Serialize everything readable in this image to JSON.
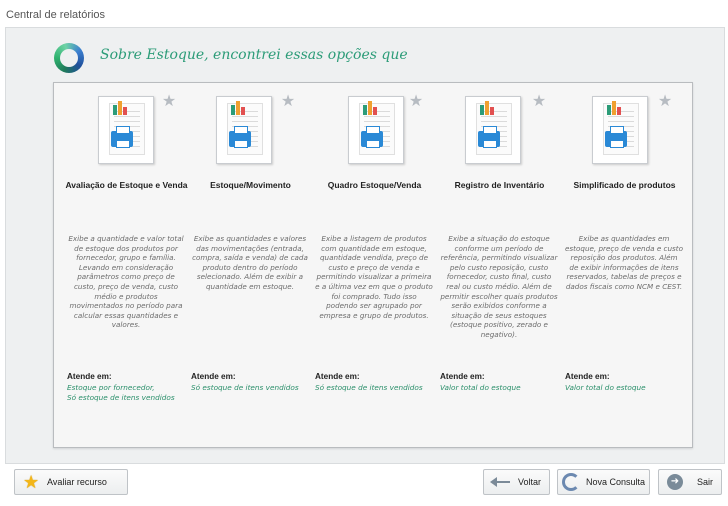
{
  "window": {
    "title": "Central de relatórios"
  },
  "header": {
    "title": "Sobre Estoque, encontrei essas opções que"
  },
  "cards": [
    {
      "title": "Avaliação de Estoque e Venda",
      "description": "Exibe a quantidade e valor total de estoque dos produtos por fornecedor, grupo e família. Levando em consideração parâmetros como preço de custo, preço de venda, custo médio e produtos movimentados no período para calcular essas quantidades e valores.",
      "attend_label": "Atende em:",
      "attend_values": [
        "Estoque por fornecedor,",
        "Só estoque de itens vendidos"
      ]
    },
    {
      "title": "Estoque/Movimento",
      "description": "Exibe as quantidades e valores das movimentações (entrada, compra, saída e venda) de cada produto dentro do período selecionado. Além de exibir a quantidade em estoque.",
      "attend_label": "Atende em:",
      "attend_values": [
        "Só estoque de itens vendidos"
      ]
    },
    {
      "title": "Quadro Estoque/Venda",
      "description": "Exibe a listagem de produtos com quantidade em estoque, quantidade vendida, preço de custo e preço de venda e permitindo visualizar a primeira e a última vez em que o produto foi comprado. Tudo isso podendo ser agrupado por empresa e grupo de produtos.",
      "attend_label": "Atende em:",
      "attend_values": [
        "Só estoque de itens vendidos"
      ]
    },
    {
      "title": "Registro de Inventário",
      "description": "Exibe a situação do estoque conforme um período de referência, permitindo visualizar pelo custo reposição, custo fornecedor, custo final, custo real ou custo médio. Além de permitir escolher quais produtos serão exibidos conforme a situação de seus estoques (estoque positivo, zerado e negativo).",
      "attend_label": "Atende em:",
      "attend_values": [
        "Valor total do estoque"
      ]
    },
    {
      "title": "Simplificado de produtos",
      "description": "Exibe as quantidades em estoque, preço de venda e custo reposição dos produtos. Além de exibir informações de itens reservados, tabelas de preços e dados fiscais como NCM e CEST.",
      "attend_label": "Atende em:",
      "attend_values": [
        "Valor total do estoque"
      ]
    }
  ],
  "footer": {
    "rate_label": "Avaliar recurso",
    "back_label": "Voltar",
    "new_query_label": "Nova Consulta",
    "exit_label": "Sair"
  },
  "colors": {
    "accent_green": "#2c9c78",
    "printer_blue": "#2a89d6",
    "star_gold": "#f3b61a"
  },
  "icons": {
    "header": "ring-logo-icon",
    "card_thumb": "report-printer-icon",
    "favorite": "star-outline-icon",
    "rate": "star-gold-icon",
    "back": "arrow-left-icon",
    "new_query": "refresh-icon",
    "exit": "exit-icon"
  }
}
